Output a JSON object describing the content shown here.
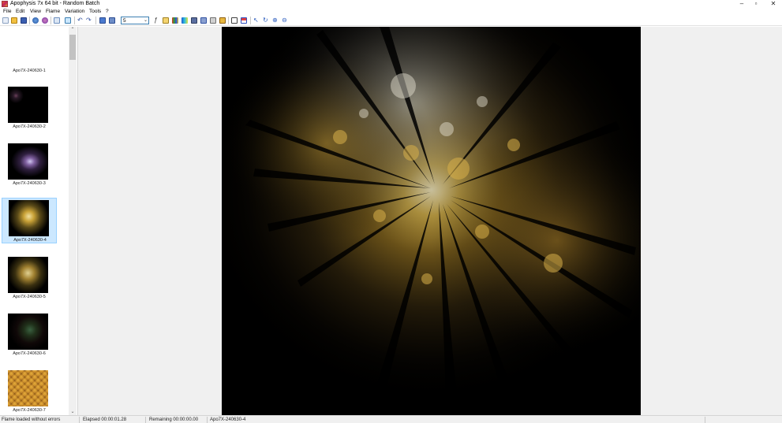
{
  "window": {
    "title": "Apophysis 7x 64 bit - Random Batch",
    "controls": {
      "minimize": "–",
      "restore": "▫",
      "close": "✕"
    }
  },
  "menu": {
    "items": [
      "File",
      "Edit",
      "View",
      "Flame",
      "Variation",
      "Tools",
      "?"
    ]
  },
  "toolbar": {
    "zoom_value": "5",
    "icons": [
      "new-icon",
      "open-icon",
      "save-icon",
      "render-icon",
      "render-all-icon",
      "list-view-icon",
      "icon-view-icon",
      "undo-icon",
      "redo-icon",
      "fullscreen-icon",
      "fullscreen-2-icon",
      "zoom-combo",
      "script-icon",
      "editor-icon",
      "palette-icon",
      "gradient-icon",
      "mutate-icon",
      "adjust-icon",
      "postprocess-icon",
      "options-icon",
      "transparency-icon",
      "guides-icon",
      "select-icon",
      "rotate-icon",
      "zoom-in-icon",
      "zoom-out-icon"
    ]
  },
  "sidebar": {
    "items": [
      {
        "label": "Apo7X-240630-1",
        "has_thumb": false,
        "selected": false
      },
      {
        "label": "Apo7X-240630-2",
        "has_thumb": true,
        "selected": false
      },
      {
        "label": "Apo7X-240630-3",
        "has_thumb": true,
        "selected": false
      },
      {
        "label": "Apo7X-240630-4",
        "has_thumb": true,
        "selected": true
      },
      {
        "label": "Apo7X-240630-5",
        "has_thumb": true,
        "selected": false
      },
      {
        "label": "Apo7X-240630-6",
        "has_thumb": true,
        "selected": false
      },
      {
        "label": "Apo7X-240630-7",
        "has_thumb": true,
        "selected": false
      }
    ],
    "scroll_up": "⌃",
    "scroll_down": "⌄"
  },
  "status": {
    "message": "Flame loaded without errors",
    "elapsed": "Elapsed 00:00:01.28",
    "remaining": "Remaining 00:00:00.00",
    "flame_name": "Apo7X-240630-4"
  },
  "colors": {
    "selection": "#cce8ff",
    "selection_border": "#99d1ff",
    "canvas_bg": "#000000",
    "fractal_gold": "#c9a237",
    "fractal_white": "#e8e4d4"
  }
}
